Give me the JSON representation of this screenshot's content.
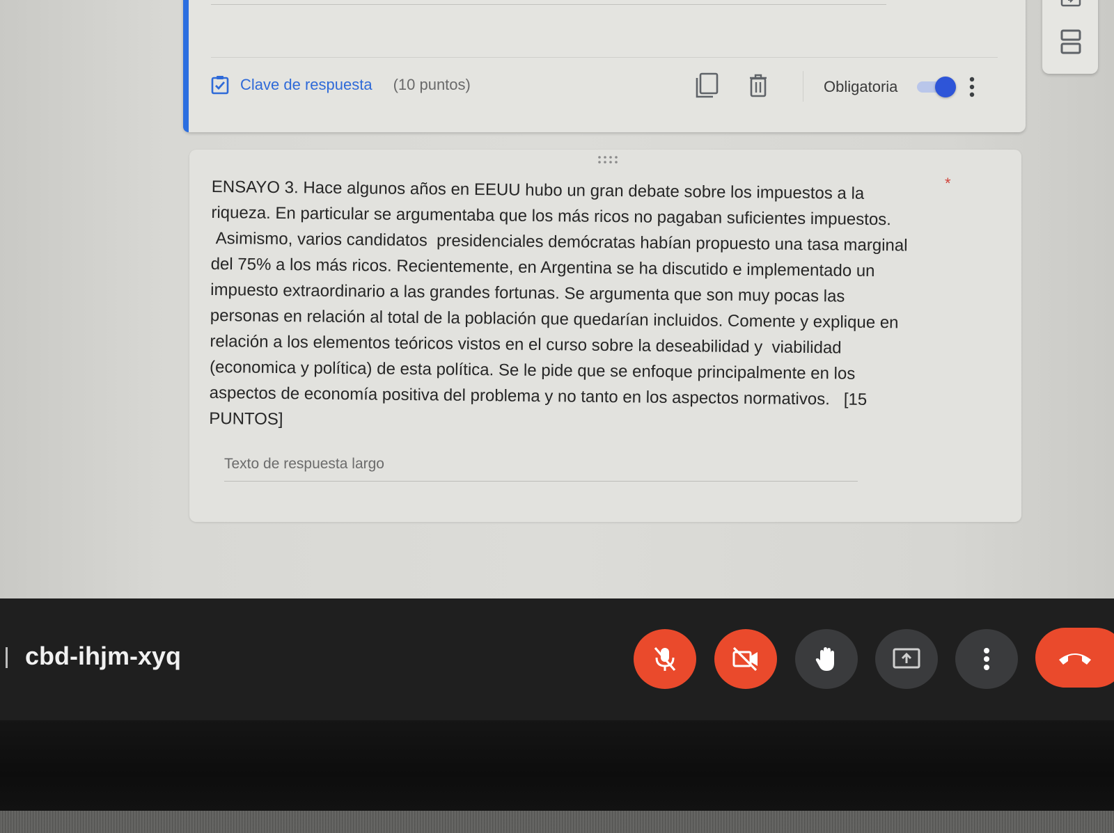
{
  "question_card_top": {
    "answer_key_label": "Clave de respuesta",
    "points_label": "(10 puntos)",
    "required_label": "Obligatoria",
    "required_on": true
  },
  "question": {
    "text": "ENSAYO 3. Hace algunos años en EEUU hubo un gran debate sobre los impuestos a la\nriqueza. En particular se argumentaba que los más ricos no pagaban suficientes impuestos.\n Asimismo, varios candidatos  presidenciales demócratas habían propuesto una tasa marginal\ndel 75% a los más ricos. Recientemente, en Argentina se ha discutido e implementado un\nimpuesto extraordinario a las grandes fortunas. Se argumenta que son muy pocas las\npersonas en relación al total de la población que quedarían incluidos. Comente y explique en\nrelación a los elementos teóricos vistos en el curso sobre la deseabilidad y  viabilidad\n(economica y política) de esta política. Se le pide que se enfoque principalmente en los\naspectos de economía positiva del problema y no tanto en los aspectos normativos.   [15\nPUNTOS]",
    "required_marker": "*",
    "answer_placeholder": "Texto de respuesta largo"
  },
  "meet": {
    "meeting_code": "cbd-ihjm-xyq",
    "mic_muted": true,
    "camera_off": true
  },
  "colors": {
    "accent_blue": "#2b6ee0",
    "meet_red": "#ea4a2c",
    "meet_bar": "#1f1f1f"
  },
  "icons": {
    "answer_key": "checkbox-checked-icon",
    "duplicate": "copy-icon",
    "delete": "trash-icon",
    "more": "more-vert-icon",
    "mic": "mic-off-icon",
    "camera": "videocam-off-icon",
    "hand": "raise-hand-icon",
    "present": "present-screen-icon",
    "leave": "call-end-icon"
  }
}
